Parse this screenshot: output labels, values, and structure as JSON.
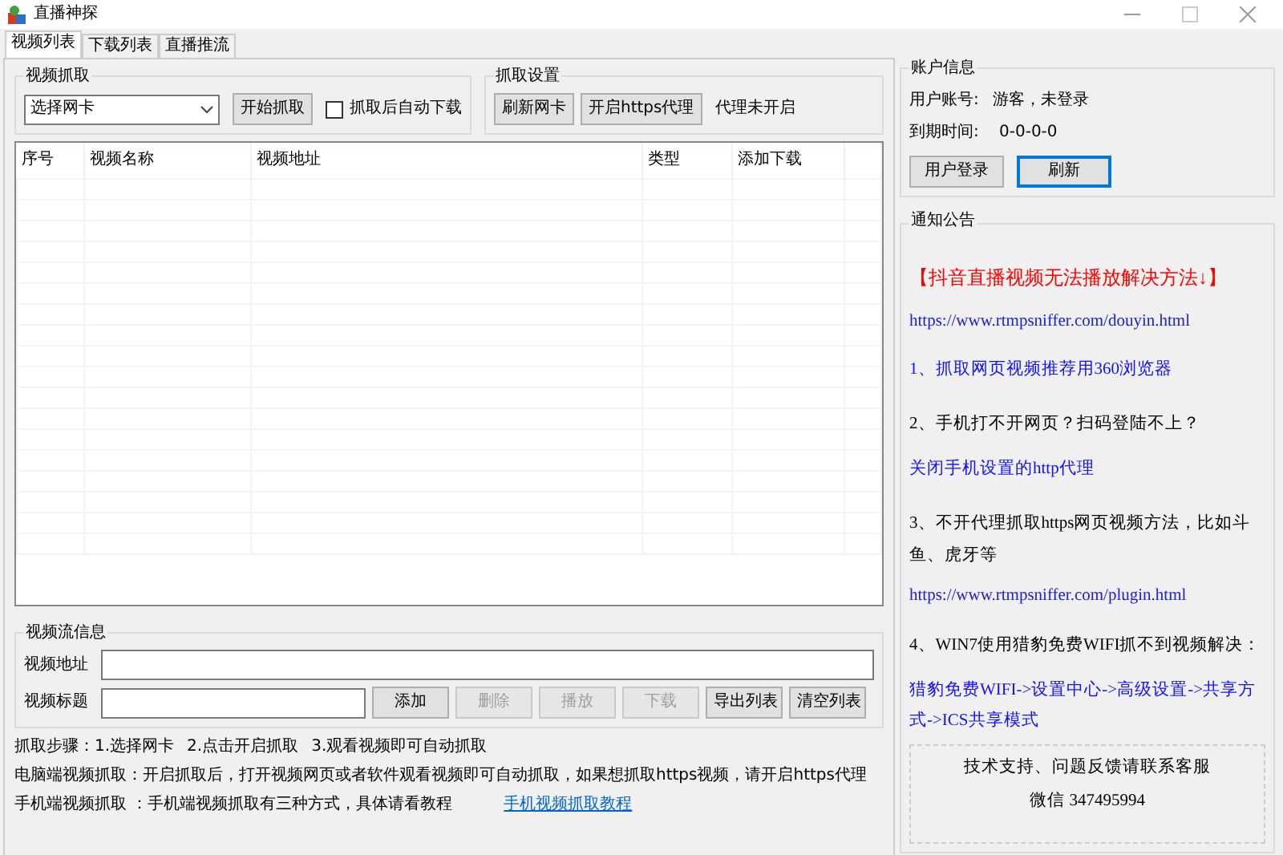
{
  "window": {
    "title": "直播神探"
  },
  "tabs": [
    {
      "label": "视频列表",
      "selected": true
    },
    {
      "label": "下载列表",
      "selected": false
    },
    {
      "label": "直播推流",
      "selected": false
    }
  ],
  "capture": {
    "title": "视频抓取",
    "nic_select": "选择网卡",
    "start_button": "开始抓取",
    "auto_download": {
      "label": "抓取后自动下载",
      "checked": false
    }
  },
  "capture_settings": {
    "title": "抓取设置",
    "buttons": [
      "刷新网卡",
      "开启https代理"
    ],
    "proxy_status": "代理未开启"
  },
  "table": {
    "columns": [
      "序号",
      "视频名称",
      "视频地址",
      "类型",
      "添加下载"
    ]
  },
  "stream_info": {
    "title": "视频流信息",
    "fields": [
      {
        "label": "视频地址"
      },
      {
        "label": "视频标题"
      }
    ],
    "buttons": [
      {
        "label": "添加",
        "disabled": false
      },
      {
        "label": "删除",
        "disabled": true
      },
      {
        "label": "播放",
        "disabled": true
      },
      {
        "label": "下载",
        "disabled": true
      },
      {
        "label": "导出列表",
        "disabled": false
      },
      {
        "label": "清空列表",
        "disabled": false
      }
    ]
  },
  "notes": [
    {
      "kind": "text",
      "texts": [
        "抓取步骤：1.选择网卡",
        "2.点击开启抓取",
        "3.观看视频即可自动抓取"
      ]
    },
    {
      "kind": "text",
      "texts": [
        "电脑端视频抓取：开启抓取后，打开视频网页或者软件观看视频即可自动抓取，如果想抓取https视频，请开启https代理"
      ]
    },
    {
      "kind": "link",
      "texts": [
        "手机端视频抓取 ：手机端视频抓取有三种方式，具体请看教程",
        "手机视频抓取教程"
      ]
    }
  ],
  "account": {
    "title": "账户信息",
    "rows": [
      {
        "label": "用户账号:",
        "value": "游客，未登录"
      },
      {
        "label": "到期时间:",
        "value": "0-0-0-0"
      }
    ],
    "buttons": [
      {
        "label": "用户登录",
        "focused": false
      },
      {
        "label": "刷新",
        "focused": true
      }
    ]
  },
  "notice": {
    "title": "通知公告",
    "items": [
      {
        "kind": "alert",
        "text": "【抖音直播视频无法播放解决方法↓】"
      },
      {
        "kind": "url",
        "text": "https://www.rtmpsniffer.com/douyin.html"
      },
      {
        "kind": "blue",
        "text": "1、抓取网页视频推荐用360浏览器"
      },
      {
        "kind": "text",
        "text": "2、手机打不开网页？扫码登陆不上？"
      },
      {
        "kind": "blue",
        "text": "关闭手机设置的http代理"
      },
      {
        "kind": "text",
        "text": "3、不开代理抓取https网页视频方法，比如斗鱼、虎牙等"
      },
      {
        "kind": "url",
        "text": "https://www.rtmpsniffer.com/plugin.html"
      },
      {
        "kind": "text",
        "text": "4、WIN7使用猎豹免费WIFI抓不到视频解决："
      },
      {
        "kind": "blue",
        "text": "猎豹免费WIFI->设置中心->高级设置->共享方式->ICS共享模式"
      }
    ],
    "support": [
      "技术支持、问题反馈请联系客服",
      "微信 347495994"
    ]
  }
}
